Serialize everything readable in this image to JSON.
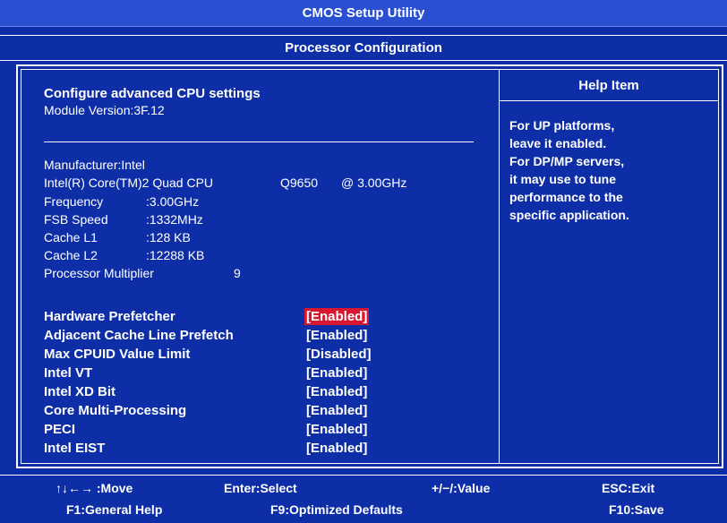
{
  "app": {
    "title": "CMOS Setup Utility",
    "subtitle": "Processor Configuration"
  },
  "left": {
    "heading": "Configure advanced CPU settings",
    "module_version": "Module Version:3F.12",
    "manufacturer": "Manufacturer:Intel",
    "cpu_name": "Intel(R) Core(TM)2 Quad CPU",
    "cpu_model": "Q9650",
    "cpu_speed": "@ 3.00GHz",
    "info": [
      {
        "label": "Frequency",
        "value": ":3.00GHz"
      },
      {
        "label": "FSB Speed",
        "value": ":1332MHz"
      },
      {
        "label": "Cache L1",
        "value": ":128 KB"
      },
      {
        "label": "Cache L2",
        "value": ":12288 KB"
      },
      {
        "label": "Processor Multiplier",
        "value": "9"
      }
    ],
    "options": [
      {
        "label": "Hardware Prefetcher",
        "value": "[Enabled]"
      },
      {
        "label": "Adjacent Cache Line Prefetch",
        "value": "[Enabled]"
      },
      {
        "label": "Max CPUID Value Limit",
        "value": "[Disabled]"
      },
      {
        "label": "Intel VT",
        "value": "[Enabled]"
      },
      {
        "label": "Intel XD Bit",
        "value": "[Enabled]"
      },
      {
        "label": "Core Multi-Processing",
        "value": "[Enabled]"
      },
      {
        "label": "PECI",
        "value": "[Enabled]"
      },
      {
        "label": "Intel EIST",
        "value": "[Enabled]"
      }
    ]
  },
  "help": {
    "title": "Help Item",
    "lines": [
      "For UP platforms,",
      "leave it enabled.",
      "For DP/MP servers,",
      "it may use to tune",
      "performance to the",
      "specific application."
    ]
  },
  "footer": {
    "move": "↑↓←→ :Move",
    "enter": "Enter:Select",
    "value": "+/−/:Value",
    "esc": "ESC:Exit",
    "f1": "F1:General Help",
    "f9": "F9:Optimized Defaults",
    "f10": "F10:Save"
  },
  "colors": {
    "background": "#0d2ea6",
    "selected": "#d8162f"
  }
}
